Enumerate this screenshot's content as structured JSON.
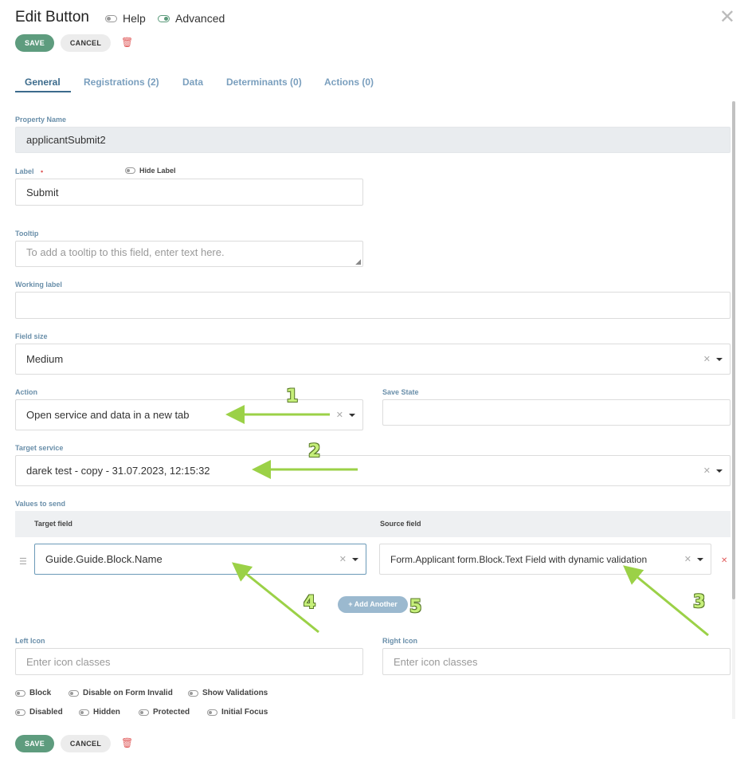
{
  "header": {
    "title": "Edit Button",
    "help_label": "Help",
    "advanced_label": "Advanced",
    "close_icon": "close-icon"
  },
  "actions": {
    "save_label": "SAVE",
    "cancel_label": "CANCEL",
    "delete_icon": "trash-icon"
  },
  "tabs": [
    {
      "label": "General"
    },
    {
      "label": "Registrations (2)"
    },
    {
      "label": "Data"
    },
    {
      "label": "Determinants (0)"
    },
    {
      "label": "Actions (0)"
    }
  ],
  "form": {
    "property_name": {
      "label": "Property Name",
      "value": "applicantSubmit2"
    },
    "label": {
      "label": "Label",
      "required_marker": "•",
      "value": "Submit",
      "hide_label": "Hide Label"
    },
    "tooltip": {
      "label": "Tooltip",
      "placeholder": "To add a tooltip to this field, enter text here."
    },
    "working_label": {
      "label": "Working label",
      "value": ""
    },
    "field_size": {
      "label": "Field size",
      "value": "Medium"
    },
    "action": {
      "label": "Action",
      "value": "Open service and data in a new tab"
    },
    "save_state": {
      "label": "Save State",
      "value": ""
    },
    "target_service": {
      "label": "Target service",
      "value": "darek test - copy - 31.07.2023, 12:15:32"
    },
    "values_to_send": {
      "label": "Values to send",
      "target_header": "Target field",
      "source_header": "Source field",
      "row": {
        "target": "Guide.Guide.Block.Name",
        "source": "Form.Applicant form.Block.Text Field with dynamic validation"
      },
      "add_another": "+ Add Another"
    },
    "left_icon": {
      "label": "Left Icon",
      "placeholder": "Enter icon classes"
    },
    "right_icon": {
      "label": "Right Icon",
      "placeholder": "Enter icon classes"
    },
    "toggles_row1": [
      "Block",
      "Disable on Form Invalid",
      "Show Validations"
    ],
    "toggles_row2": [
      "Disabled",
      "Hidden",
      "Protected",
      "Initial Focus"
    ]
  },
  "annotations": [
    "1",
    "2",
    "3",
    "4",
    "5"
  ],
  "colors": {
    "accent": "#5e9c7e",
    "tab_active": "#3c6b8c",
    "annotation": "#9bd147"
  }
}
